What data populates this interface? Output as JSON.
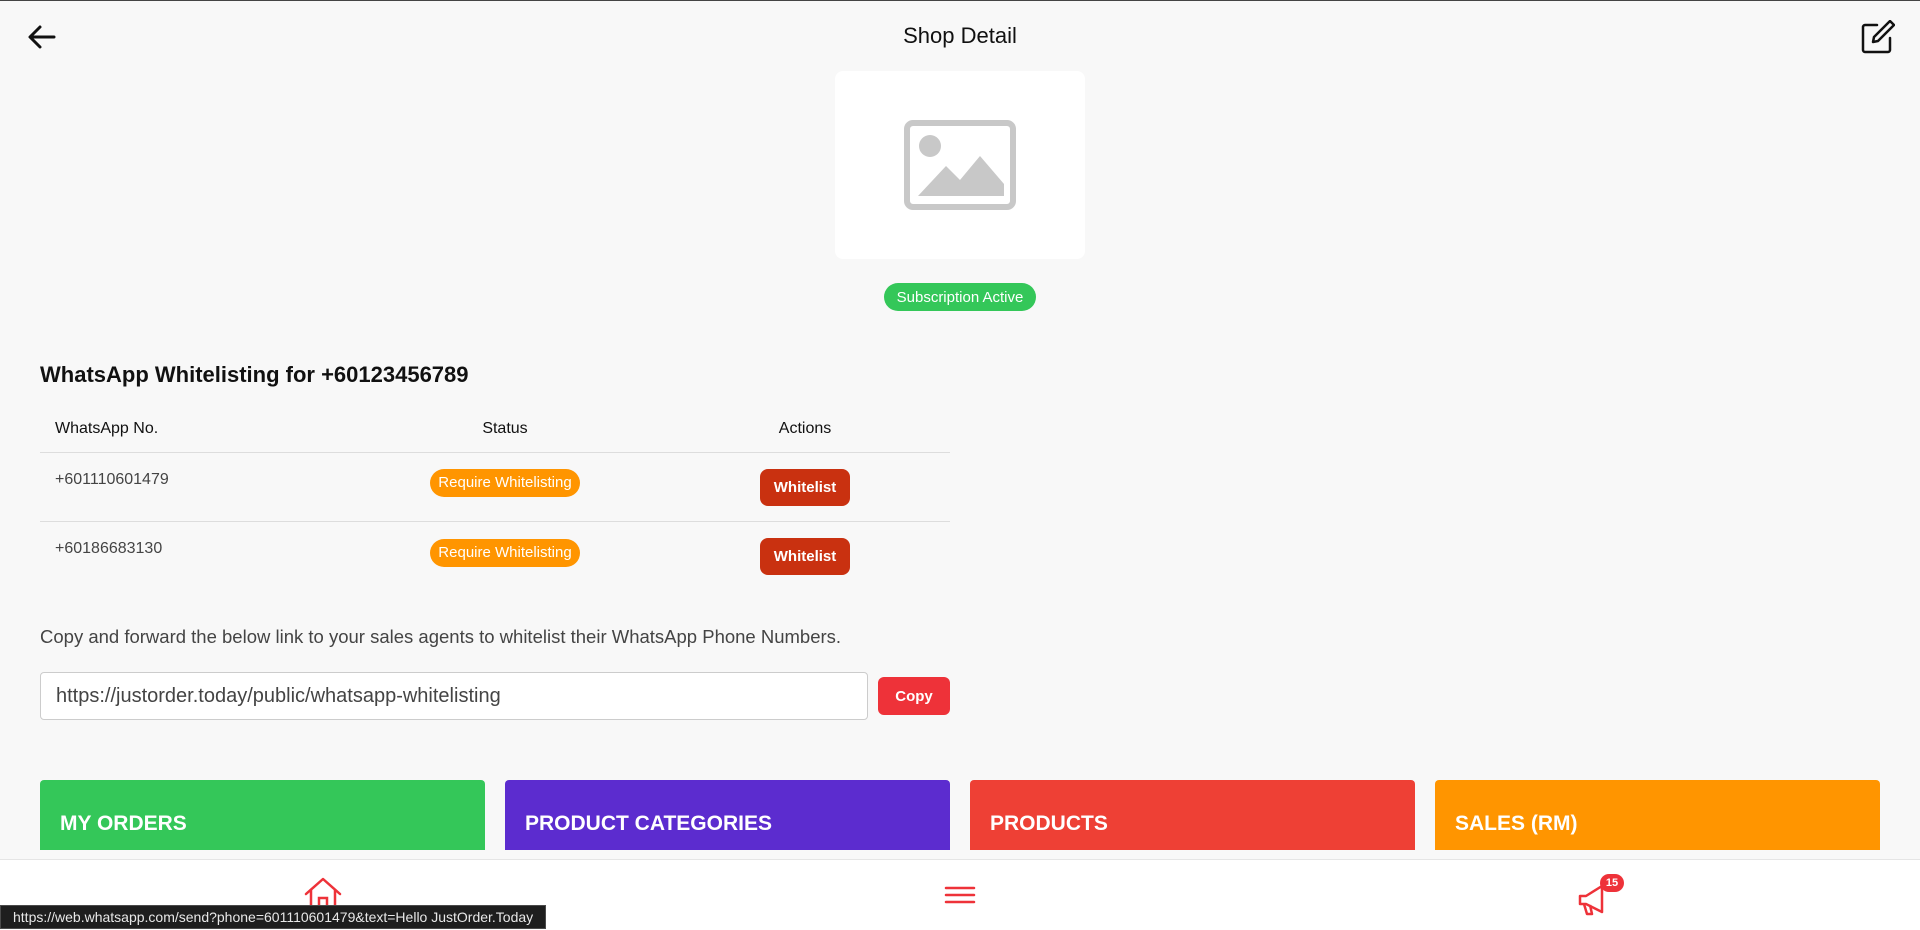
{
  "header": {
    "title": "Shop Detail",
    "back_icon": "arrow-left-icon",
    "edit_icon": "edit-icon"
  },
  "shop": {
    "image_icon": "image-placeholder-icon",
    "subscription_status": "Subscription Active"
  },
  "whitelisting": {
    "title": "WhatsApp Whitelisting for +60123456789",
    "columns": {
      "number": "WhatsApp No.",
      "status": "Status",
      "actions": "Actions"
    },
    "rows": [
      {
        "number": "+601110601479",
        "status": "Require Whitelisting",
        "action": "Whitelist"
      },
      {
        "number": "+60186683130",
        "status": "Require Whitelisting",
        "action": "Whitelist"
      }
    ]
  },
  "share": {
    "instruction": "Copy and forward the below link to your sales agents to whitelist their WhatsApp Phone Numbers.",
    "link": "https://justorder.today/public/whatsapp-whitelisting",
    "copy_label": "Copy"
  },
  "tiles": [
    {
      "label": "MY ORDERS",
      "color": "#34c759"
    },
    {
      "label": "PRODUCT CATEGORIES",
      "color": "#5c2ccf"
    },
    {
      "label": "PRODUCTS",
      "color": "#ee4035"
    },
    {
      "label": "SALES (RM)",
      "color": "#ff9500"
    }
  ],
  "bottom_nav": {
    "home_icon": "home-icon",
    "menu_icon": "menu-icon",
    "announce_icon": "megaphone-icon",
    "notification_count": "15"
  },
  "status_bar": {
    "url": "https://web.whatsapp.com/send?phone=601110601479&text=Hello JustOrder.Today"
  },
  "colors": {
    "accent_red": "#ee3239",
    "success_green": "#34c759",
    "warning_orange": "#ff9500",
    "whitelist_btn": "#c93110"
  }
}
